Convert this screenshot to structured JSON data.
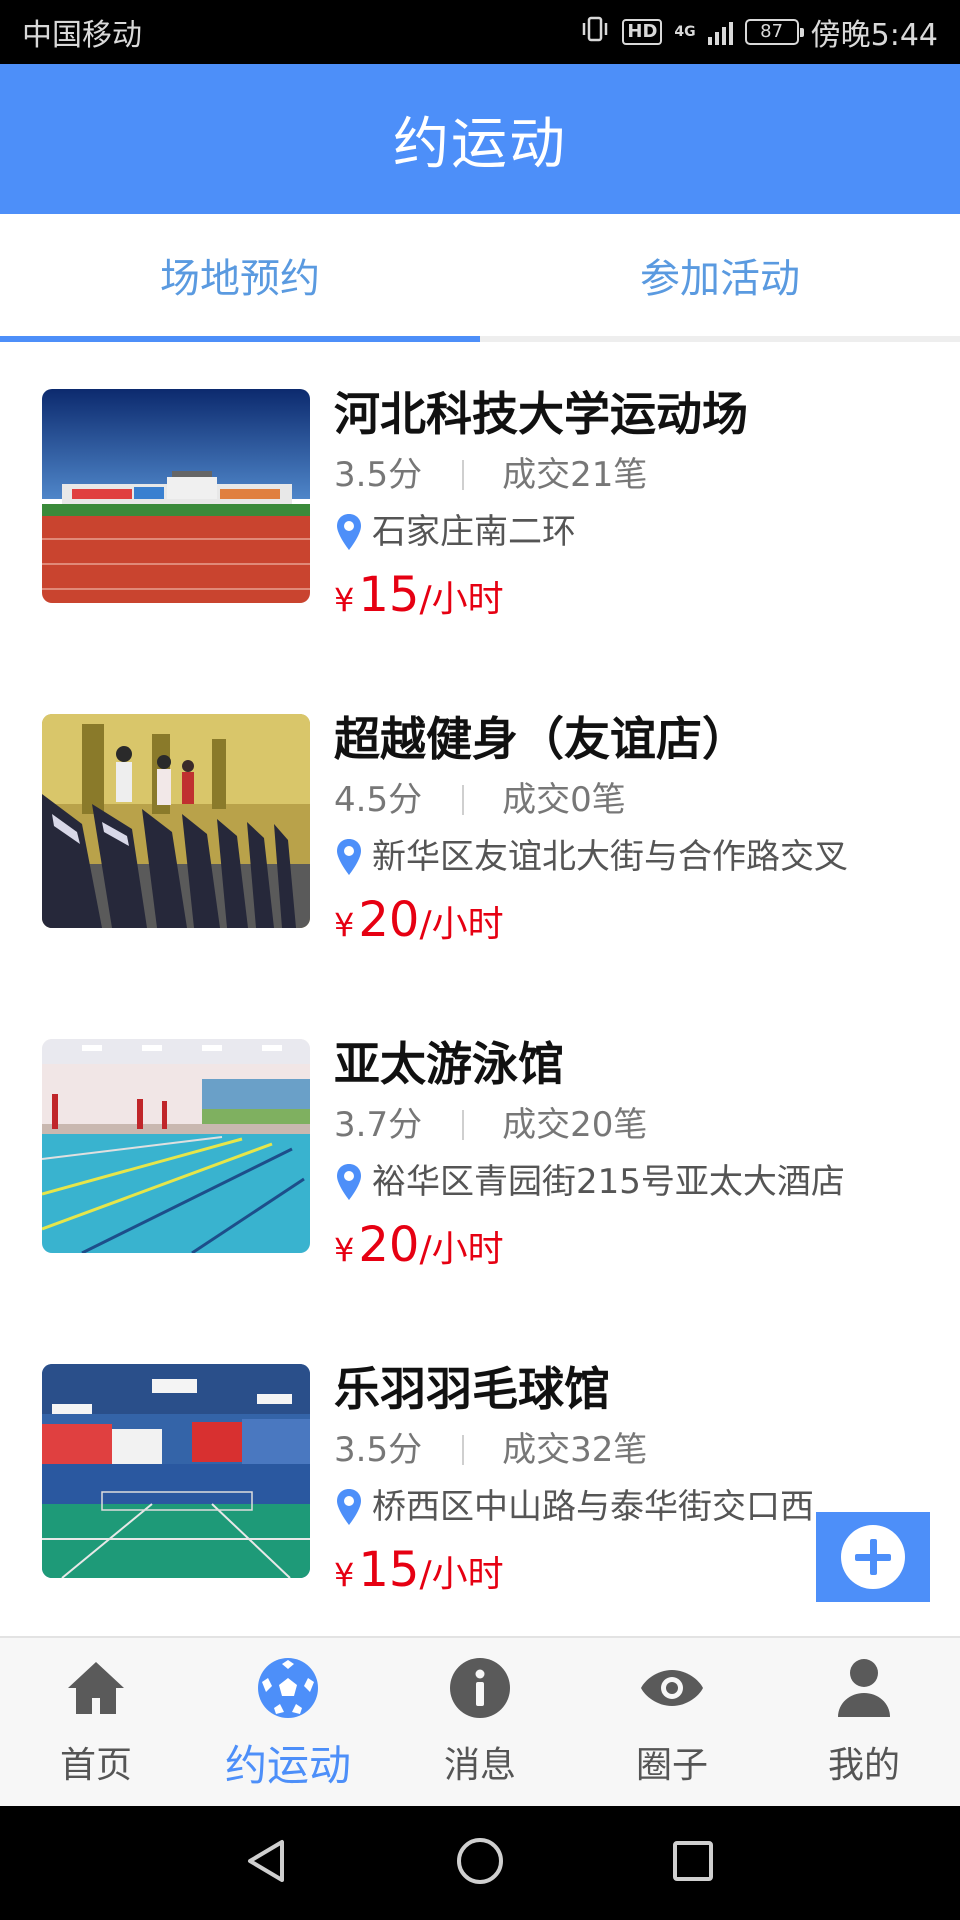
{
  "status_bar": {
    "carrier": "中国移动",
    "hd": "HD",
    "network": "4G",
    "battery": "87",
    "time": "傍晚5:44"
  },
  "app_bar": {
    "title": "约运动"
  },
  "tabs": [
    {
      "label": "场地预约",
      "active": true
    },
    {
      "label": "参加活动",
      "active": false
    }
  ],
  "venues": [
    {
      "name": "河北科技大学运动场",
      "rating": "3.5分",
      "deals": "成交21笔",
      "address": "石家庄南二环",
      "currency": "¥",
      "price": "15",
      "unit": "/小时",
      "image": "stadium"
    },
    {
      "name": "超越健身（友谊店）",
      "rating": "4.5分",
      "deals": "成交0笔",
      "address": "新华区友谊北大街与合作路交叉",
      "currency": "¥",
      "price": "20",
      "unit": "/小时",
      "image": "gym-treadmills"
    },
    {
      "name": "亚太游泳馆",
      "rating": "3.7分",
      "deals": "成交20笔",
      "address": "裕华区青园街215号亚太大酒店",
      "currency": "¥",
      "price": "20",
      "unit": "/小时",
      "image": "swimming-pool"
    },
    {
      "name": "乐羽羽毛球馆",
      "rating": "3.5分",
      "deals": "成交32笔",
      "address": "桥西区中山路与泰华街交口西",
      "currency": "¥",
      "price": "15",
      "unit": "/小时",
      "image": "badminton-hall"
    }
  ],
  "fab": {
    "icon": "plus-icon"
  },
  "bottom_nav": [
    {
      "label": "首页",
      "icon": "home-icon",
      "active": false
    },
    {
      "label": "约运动",
      "icon": "soccer-ball-icon",
      "active": true
    },
    {
      "label": "消息",
      "icon": "info-icon",
      "active": false
    },
    {
      "label": "圈子",
      "icon": "eye-icon",
      "active": false
    },
    {
      "label": "我的",
      "icon": "person-icon",
      "active": false
    }
  ],
  "colors": {
    "primary": "#4d8ff9",
    "price": "#e60012",
    "tab_text": "#5a9ae0"
  }
}
